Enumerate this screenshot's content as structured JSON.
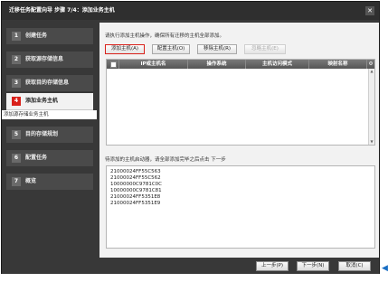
{
  "window": {
    "title": "迁移任务配置向导 步骤 7/4：添加业务主机"
  },
  "sidebar": {
    "steps": [
      {
        "num": "1",
        "label": "创建任务"
      },
      {
        "num": "2",
        "label": "获取源存储信息"
      },
      {
        "num": "3",
        "label": "获取目的存储信息"
      },
      {
        "num": "4",
        "label": "添加业务主机"
      },
      {
        "num": "5",
        "label": "目的存储规划"
      },
      {
        "num": "6",
        "label": "配置任务"
      },
      {
        "num": "7",
        "label": "概览"
      }
    ],
    "substep": "添加源存储业务主机",
    "active_step": "4"
  },
  "main": {
    "instruction": "请执行添加主机操作，确保所有迁移的主机全部添加。",
    "buttons": {
      "add_host": "添加主机(A)",
      "config_host": "配置主机(O)",
      "remove_host": "移除主机(R)",
      "ignore_host": "忽略主机(E)"
    },
    "table": {
      "columns": [
        "IP或主机名",
        "操作系统",
        "主机访问模式",
        "映射名称"
      ]
    },
    "pending_label": "待添加的主机启动器，请全部添加完毕之后点击 下一步",
    "initiators": [
      "21000024FF55C563",
      "21000024FF55C562",
      "10000000C9781C0C",
      "10000000C9781C81",
      "21000024FF5351E8",
      "21000024FF5351E9"
    ]
  },
  "footer": {
    "prev": "上一步(P)",
    "next": "下一步(N)",
    "cancel": "取消(C)"
  },
  "colors": {
    "accent": "#d9201a",
    "frame": "#383838"
  }
}
